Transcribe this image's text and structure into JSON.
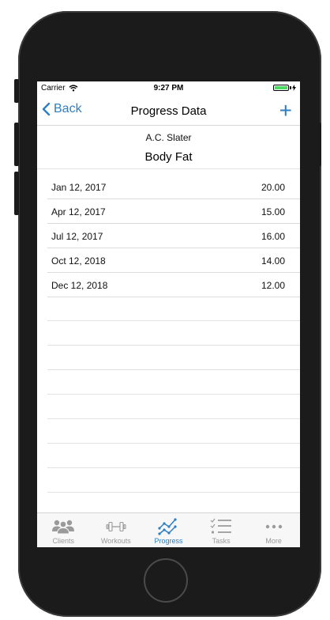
{
  "status_bar": {
    "carrier": "Carrier",
    "time": "9:27 PM"
  },
  "nav": {
    "back_label": "Back",
    "title": "Progress Data",
    "add_symbol": "+"
  },
  "client": {
    "name": "A.C. Slater"
  },
  "metric": {
    "name": "Body Fat"
  },
  "entries": [
    {
      "date": "Jan 12, 2017",
      "value": "20.00"
    },
    {
      "date": "Apr 12, 2017",
      "value": "15.00"
    },
    {
      "date": "Jul 12, 2017",
      "value": "16.00"
    },
    {
      "date": "Oct 12, 2018",
      "value": "14.00"
    },
    {
      "date": "Dec 12, 2018",
      "value": "12.00"
    }
  ],
  "tabs": [
    {
      "label": "Clients",
      "icon": "clients-icon",
      "active": false
    },
    {
      "label": "Workouts",
      "icon": "dumbbell-icon",
      "active": false
    },
    {
      "label": "Progress",
      "icon": "progress-chart-icon",
      "active": true
    },
    {
      "label": "Tasks",
      "icon": "checklist-icon",
      "active": false
    },
    {
      "label": "More",
      "icon": "more-icon",
      "active": false
    }
  ],
  "colors": {
    "accent": "#2f7ec1",
    "inactive": "#9a9a9a",
    "battery": "#4cd964"
  }
}
